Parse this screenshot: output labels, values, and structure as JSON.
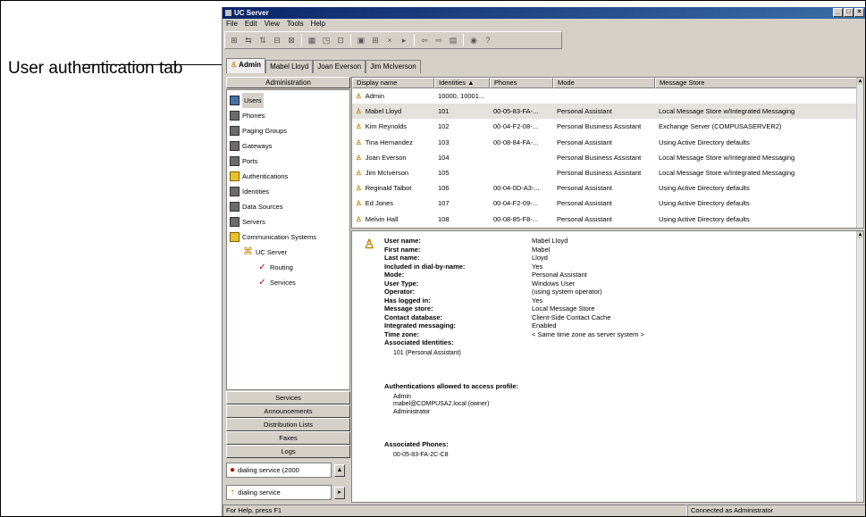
{
  "callout": {
    "text": "User authentication tab"
  },
  "window": {
    "title": "UC Server",
    "btn_min": "_",
    "btn_max": "□",
    "btn_close": "×"
  },
  "menu": [
    "File",
    "Edit",
    "View",
    "Tools",
    "Help"
  ],
  "toolbar": [
    "⊞",
    "⇆",
    "⇅",
    "⊟",
    "⊠",
    "▦",
    "◳",
    "⊡",
    "▣",
    "⊞",
    "×",
    "▸",
    "⇦",
    "⇨",
    "▤",
    "◉",
    "?"
  ],
  "tabs": [
    {
      "label": "Admin",
      "active": true
    },
    {
      "label": "Mabel Lloyd",
      "active": false
    },
    {
      "label": "Joan Everson",
      "active": false
    },
    {
      "label": "Jim McIverson",
      "active": false
    }
  ],
  "left": {
    "header": "Administration",
    "tree": [
      {
        "label": "Users",
        "icon": "users-icon",
        "level": 0,
        "selected": true
      },
      {
        "label": "Phones",
        "icon": "phone-icon",
        "level": 0
      },
      {
        "label": "Paging Groups",
        "icon": "paging-icon",
        "level": 0
      },
      {
        "label": "Gateways",
        "icon": "gateway-icon",
        "level": 0
      },
      {
        "label": "Ports",
        "icon": "port-icon",
        "level": 0
      },
      {
        "label": "Authentications",
        "icon": "key-icon",
        "level": 0
      },
      {
        "label": "Identities",
        "icon": "identity-icon",
        "level": 0
      },
      {
        "label": "Data Sources",
        "icon": "database-icon",
        "level": 0
      },
      {
        "label": "Servers",
        "icon": "server-icon",
        "level": 0
      },
      {
        "label": "Communication Systems",
        "icon": "comm-system-icon",
        "level": 0
      },
      {
        "label": "UC Server",
        "icon": "uc-server-icon",
        "level": 1
      },
      {
        "label": "Routing",
        "icon": "routing-icon",
        "level": 2
      },
      {
        "label": "Services",
        "icon": "services-icon",
        "level": 2
      }
    ],
    "nav_buttons": [
      "Services",
      "Announcements",
      "Distribution Lists",
      "Faxes",
      "Logs"
    ],
    "service1": "dialing service (2000",
    "service2": "dialing service"
  },
  "grid": {
    "columns": [
      "Display name",
      "Identities ▲",
      "Phones",
      "Mode",
      "Message Store"
    ],
    "rows": [
      {
        "name": "Admin",
        "id": "10000, 10001...",
        "phone": "",
        "mode": "",
        "store": ""
      },
      {
        "name": "Mabel Lloyd",
        "id": "101",
        "phone": "00-05-83-FA-...",
        "mode": "Personal Assistant",
        "store": "Local Message Store w/Integrated Messaging",
        "selected": true
      },
      {
        "name": "Kim Reynolds",
        "id": "102",
        "phone": "00-04-F2-08-...",
        "mode": "Personal Business Assistant",
        "store": "Exchange Server (COMPUSASERVER2)"
      },
      {
        "name": "Tina Hernandez",
        "id": "103",
        "phone": "00-08-84-FA-...",
        "mode": "Personal Assistant",
        "store": "Using Active Directory defaults"
      },
      {
        "name": "Joan Everson",
        "id": "104",
        "phone": "",
        "mode": "Personal Business Assistant",
        "store": "Local Message Store w/Integrated Messaging"
      },
      {
        "name": "Jim McIverson",
        "id": "105",
        "phone": "",
        "mode": "Personal Business Assistant",
        "store": "Local Message Store w/Integrated Messaging"
      },
      {
        "name": "Reginald Talbot",
        "id": "106",
        "phone": "00-04-0D-A3-...",
        "mode": "Personal Assistant",
        "store": "Using Active Directory defaults"
      },
      {
        "name": "Ed Jones",
        "id": "107",
        "phone": "00-04-F2-09-...",
        "mode": "Personal Assistant",
        "store": "Using Active Directory defaults"
      },
      {
        "name": "Melvin Hall",
        "id": "108",
        "phone": "00-08-85-F8-...",
        "mode": "Personal Assistant",
        "store": "Using Active Directory defaults"
      }
    ]
  },
  "detail": {
    "fields": [
      {
        "k": "User name:",
        "v": "Mabel Lloyd"
      },
      {
        "k": "First name:",
        "v": "Mabel"
      },
      {
        "k": "Last name:",
        "v": "Lloyd"
      },
      {
        "k": "Included in dial-by-name:",
        "v": "Yes"
      },
      {
        "k": "Mode:",
        "v": "Personal Assistant"
      },
      {
        "k": "User Type:",
        "v": "Windows User"
      },
      {
        "k": "Operator:",
        "v": "(using system operator)"
      },
      {
        "k": "Has logged in:",
        "v": "Yes"
      },
      {
        "k": "Message store:",
        "v": "Local Message Store"
      },
      {
        "k": "Contact database:",
        "v": "Client-Side Contact Cache"
      },
      {
        "k": "Integrated messaging:",
        "v": "Enabled"
      },
      {
        "k": "Time zone:",
        "v": "< Same time zone as server system >"
      }
    ],
    "identities_title": "Associated Identities:",
    "identities": [
      "101 (Personal Assistant)"
    ],
    "auth_title": "Authentications allowed to access profile:",
    "auth": [
      "Admin",
      "mabel@COMPUSA2.local (owner)",
      "Administrator"
    ],
    "phones_title": "Associated Phones:",
    "phones": [
      "00-05-83-FA-2C-C8"
    ]
  },
  "status": {
    "left": "For Help, press F1",
    "right": "Connected as Administrator"
  }
}
